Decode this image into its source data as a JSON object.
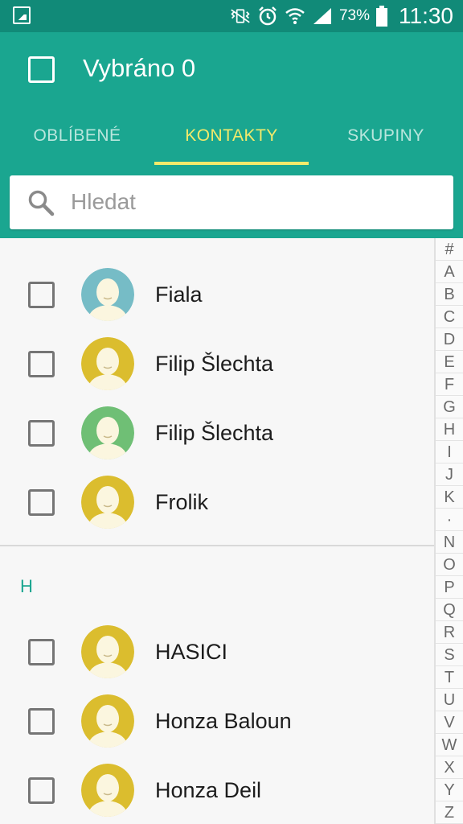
{
  "status": {
    "battery": "73%",
    "time": "11:30"
  },
  "header": {
    "title": "Vybráno 0"
  },
  "tabs": [
    {
      "label": "OBLÍBENÉ",
      "active": false
    },
    {
      "label": "KONTAKTY",
      "active": true
    },
    {
      "label": "SKUPINY",
      "active": false
    }
  ],
  "search": {
    "placeholder": "Hledat"
  },
  "contacts_f": [
    {
      "name": "Fiala",
      "avatar_color": "#76bcc6",
      "icon": "person-avatar-icon"
    },
    {
      "name": "Filip Šlechta",
      "avatar_color": "#dbbd2e",
      "icon": "person-avatar-icon"
    },
    {
      "name": "Filip Šlechta",
      "avatar_color": "#6fbf75",
      "icon": "person-avatar-icon"
    },
    {
      "name": "Frolik",
      "avatar_color": "#dbbd2e",
      "icon": "person-avatar-icon"
    }
  ],
  "section_h": {
    "letter": "H"
  },
  "contacts_h": [
    {
      "name": "HASICI",
      "avatar_color": "#dbbd2e",
      "icon": "person-avatar-icon"
    },
    {
      "name": "Honza Baloun",
      "avatar_color": "#dbbd2e",
      "icon": "person-avatar-icon"
    },
    {
      "name": "Honza Deil",
      "avatar_color": "#dbbd2e",
      "icon": "person-avatar-icon"
    }
  ],
  "index": [
    "#",
    "A",
    "B",
    "C",
    "D",
    "E",
    "F",
    "G",
    "H",
    "I",
    "J",
    "K",
    "·",
    "N",
    "O",
    "P",
    "Q",
    "R",
    "S",
    "T",
    "U",
    "V",
    "W",
    "X",
    "Y",
    "Z"
  ],
  "colors": {
    "statusbar": "#118a78",
    "appbar": "#1aa690",
    "tab_active": "#f3ea6b",
    "section_letter": "#1aa690"
  }
}
